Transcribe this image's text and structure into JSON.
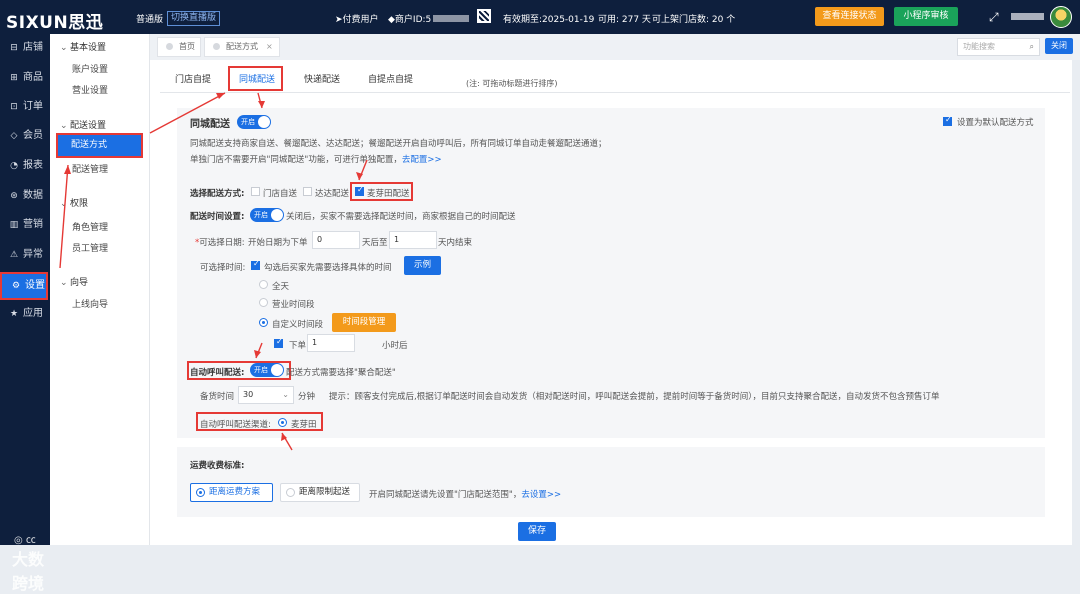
{
  "topbar": {
    "logo": "SIXUN思迅",
    "edition": "普通版",
    "switch_label": "切换直播版",
    "paid_user": "付费用户",
    "merchant_id_label": "商户ID:5",
    "valid_until": "有效期至:2025-01-19",
    "available": "可用: 277 天",
    "stores": "可上架门店数: 20 个",
    "btn_check": "查看连接状态",
    "btn_miniapp": "小程序审核",
    "fullscreen_icon": "fullscreen-icon"
  },
  "leftnav": [
    {
      "icon": "⊟",
      "label": "店铺"
    },
    {
      "icon": "⊞",
      "label": "商品"
    },
    {
      "icon": "⊡",
      "label": "订单"
    },
    {
      "icon": "◇",
      "label": "会员"
    },
    {
      "icon": "◔",
      "label": "报表"
    },
    {
      "icon": "⊛",
      "label": "数据"
    },
    {
      "icon": "▥",
      "label": "营销"
    },
    {
      "icon": "⚠",
      "label": "异常"
    },
    {
      "icon": "⚙",
      "label": "设置"
    },
    {
      "icon": "★",
      "label": "应用"
    }
  ],
  "subnav": {
    "group1": "基本设置",
    "account": "账户设置",
    "business": "营业设置",
    "group2": "配送设置",
    "delivery_method": "配送方式",
    "delivery_manage": "配送管理",
    "group3": "权限",
    "roles": "角色管理",
    "staff": "员工管理",
    "group4": "向导",
    "guide": "上线向导"
  },
  "pagetabs": {
    "home": "首页",
    "delivery": "配送方式",
    "close": "×",
    "search_placeholder": "功能搜索",
    "close_btn": "关闭"
  },
  "conf_tabs": [
    "门店自提",
    "同城配送",
    "快递配送",
    "自提点自提"
  ],
  "note": "(注: 可拖动标题进行排序)",
  "section": {
    "title": "同城配送",
    "toggle_on": "开启",
    "default_label": "设置为默认配送方式",
    "desc1": "同城配送支持商家自送、餐遛配送、达达配送；餐遛配送开启自动呼叫后，所有同城订单自动走餐遛配送通道；",
    "desc2": "单独门店不需要开启\"同城配送\"功能，可进行单独配置，",
    "desc2_link": "去配置>>",
    "choose_label": "选择配送方式:",
    "opt_self": "门店自送",
    "opt_dada": "达达配送",
    "opt_mai": "麦芽田配送",
    "time_label": "配送时间设置:",
    "time_desc": "关闭后，买家不需要选择配送时间，商家根据自己的时间配送",
    "date_label": "可选择日期:",
    "date_pre": "开始日期为下单",
    "date_val1": "0",
    "date_mid": "天后至",
    "date_val2": "1",
    "date_post": "天内结束",
    "time_choose_label": "可选择时间:",
    "time_check": "勾选后买家先需要选择具体的时间",
    "example_btn": "示例",
    "radio_all": "全天",
    "radio_business": "营业时间段",
    "radio_custom": "自定义时间段",
    "time_manage_btn": "时间段管理",
    "order_pre": "下单",
    "order_val": "1",
    "order_post": "小时后",
    "auto_label": "自动呼叫配送:",
    "auto_desc": "配送方式需要选择\"聚合配送\"",
    "prep_label": "备货时间",
    "prep_val": "30",
    "prep_unit": "分钟",
    "prep_tip": "提示：顾客支付完成后,根据订单配送时间会自动发货（相对配送时间，呼叫配送会提前，提前时间等于备货时间），目前只支持聚合配送，自动发货不包含预售订单",
    "channel_label": "自动呼叫配送渠道:",
    "channel_val": "麦芽田"
  },
  "fee": {
    "title": "运费收费标准:",
    "opt1": "距离运费方案",
    "opt2": "距离限制起送",
    "hint": "开启同城配送请先设置\"门店配送范围\"，",
    "hint_link": "去设置>>"
  },
  "save": "保存",
  "watermark": "大数跨境",
  "colors": {
    "primary": "#1b6fe3",
    "nav_bg": "#0e1f3d",
    "highlight": "#e53935",
    "orange": "#f39a1b",
    "green": "#1aa35a"
  }
}
